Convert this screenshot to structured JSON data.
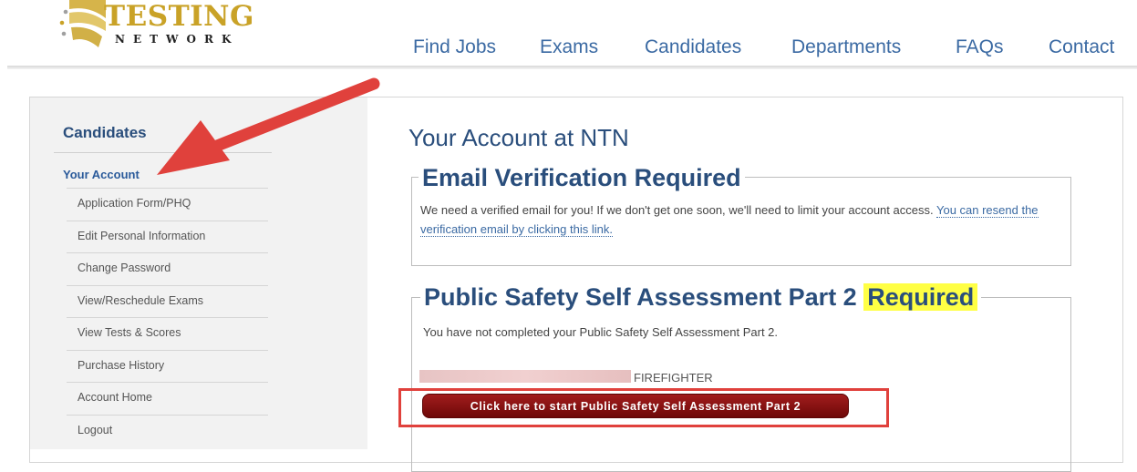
{
  "header": {
    "logo_main": "TESTING",
    "logo_sub": "NETWORK",
    "nav": [
      "Find Jobs",
      "Exams",
      "Candidates",
      "Departments",
      "FAQs",
      "Contact"
    ]
  },
  "sidebar": {
    "title": "Candidates",
    "current": "Your Account",
    "items": [
      "Application Form/PHQ",
      "Edit Personal Information",
      "Change Password",
      "View/Reschedule Exams",
      "View Tests & Scores",
      "Purchase History",
      "Account Home",
      "Logout"
    ]
  },
  "main": {
    "title": "Your Account at NTN",
    "email_section": {
      "legend": "Email Verification Required",
      "message": "We need a verified email for you! If we don't get one soon, we'll need to limit your account access.",
      "link": "You can resend the verification email by clicking this link."
    },
    "pssa_section": {
      "legend": "Public Safety Self Assessment Part 2",
      "legend_highlight": "Required",
      "message": "You have not completed your Public Safety Self Assessment Part 2.",
      "job_label": "FIREFIGHTER",
      "button": "Click here to start Public Safety Self Assessment Part 2"
    }
  },
  "colors": {
    "brand_blue": "#2a4e7c",
    "link_blue": "#3b6aa3",
    "logo_gold": "#c9a227",
    "button_red": "#8b1010",
    "annotation_red": "#e0413c",
    "highlight_yellow": "#ffff44"
  }
}
